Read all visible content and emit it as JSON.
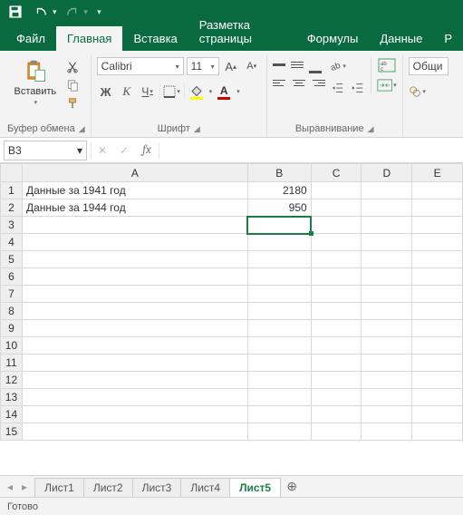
{
  "titlebar": {
    "save": "save",
    "undo": "undo",
    "redo": "redo"
  },
  "tabs": {
    "file": "Файл",
    "home": "Главная",
    "insert": "Вставка",
    "layout": "Разметка страницы",
    "formulas": "Формулы",
    "data": "Данные",
    "review": "Р"
  },
  "ribbon": {
    "clipboard": {
      "paste": "Вставить",
      "label": "Буфер обмена"
    },
    "font": {
      "name": "Calibri",
      "size": "11",
      "label": "Шрифт",
      "bold": "Ж",
      "italic": "К",
      "underline": "Ч"
    },
    "alignment": {
      "label": "Выравнивание"
    },
    "number": {
      "format": "Общи"
    }
  },
  "formula_bar": {
    "namebox": "B3",
    "fx": "fx",
    "value": ""
  },
  "grid": {
    "columns": [
      "A",
      "B",
      "C",
      "D",
      "E"
    ],
    "rows": [
      "1",
      "2",
      "3",
      "4",
      "5",
      "6",
      "7",
      "8",
      "9",
      "10",
      "11",
      "12",
      "13",
      "14",
      "15"
    ],
    "data": {
      "A1": "Данные за 1941 год",
      "B1": "2180",
      "A2": "Данные за 1944 год",
      "B2": "950"
    },
    "active_cell": "B3"
  },
  "sheets": {
    "items": [
      "Лист1",
      "Лист2",
      "Лист3",
      "Лист4",
      "Лист5"
    ],
    "active": "Лист5"
  },
  "status": {
    "text": "Готово"
  }
}
